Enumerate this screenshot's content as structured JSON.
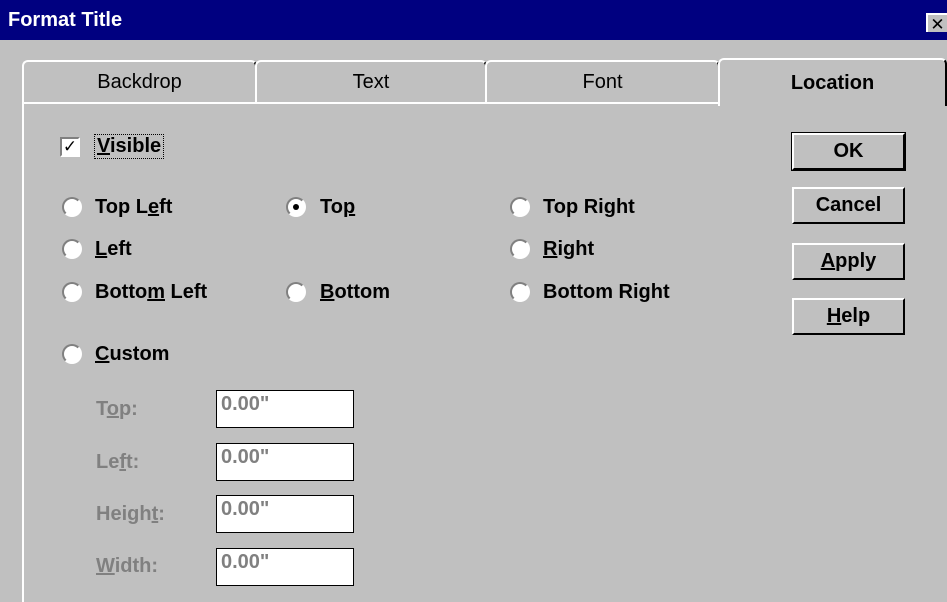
{
  "window": {
    "title": "Format Title",
    "close_glyph": "✕"
  },
  "tabs": [
    {
      "label": "Backdrop",
      "active": false
    },
    {
      "label": "Text",
      "active": false
    },
    {
      "label": "Font",
      "active": false
    },
    {
      "label": "Location",
      "active": true
    }
  ],
  "visible_checkbox": {
    "label_before": "",
    "label_key": "V",
    "label_after": "isible",
    "checked": true,
    "check_glyph": "✓"
  },
  "positions": {
    "top_left": {
      "pre": "Top L",
      "key": "e",
      "post": "ft",
      "selected": false
    },
    "top": {
      "pre": "To",
      "key": "p",
      "post": "",
      "selected": true
    },
    "top_right": {
      "pre": "Top Ri",
      "key": "g",
      "post": "ht",
      "selected": false
    },
    "left": {
      "pre": "",
      "key": "L",
      "post": "eft",
      "selected": false
    },
    "right": {
      "pre": "",
      "key": "R",
      "post": "ight",
      "selected": false
    },
    "bottom_left": {
      "pre": "Botto",
      "key": "m",
      "post": " Left",
      "selected": false
    },
    "bottom": {
      "pre": "",
      "key": "B",
      "post": "ottom",
      "selected": false
    },
    "bottom_right": {
      "pre": "Bottom Ri",
      "key": "g",
      "post": "ht",
      "selected": false
    },
    "custom": {
      "pre": "",
      "key": "C",
      "post": "ustom",
      "selected": false
    }
  },
  "buttons": {
    "ok": {
      "pre": "OK",
      "key": "",
      "post": ""
    },
    "cancel": {
      "pre": "Cancel",
      "key": "",
      "post": ""
    },
    "apply": {
      "pre": "",
      "key": "A",
      "post": "pply"
    },
    "help": {
      "pre": "",
      "key": "H",
      "post": "elp"
    }
  },
  "custom_fields": {
    "top": {
      "pre": "T",
      "key": "o",
      "post": "p:",
      "value": "0.00\""
    },
    "left": {
      "pre": "Le",
      "key": "f",
      "post": "t:",
      "value": "0.00\""
    },
    "height": {
      "pre": "Heigh",
      "key": "t",
      "post": ":",
      "value": "0.00\""
    },
    "width": {
      "pre": "",
      "key": "W",
      "post": "idth:",
      "value": "0.00\""
    }
  }
}
